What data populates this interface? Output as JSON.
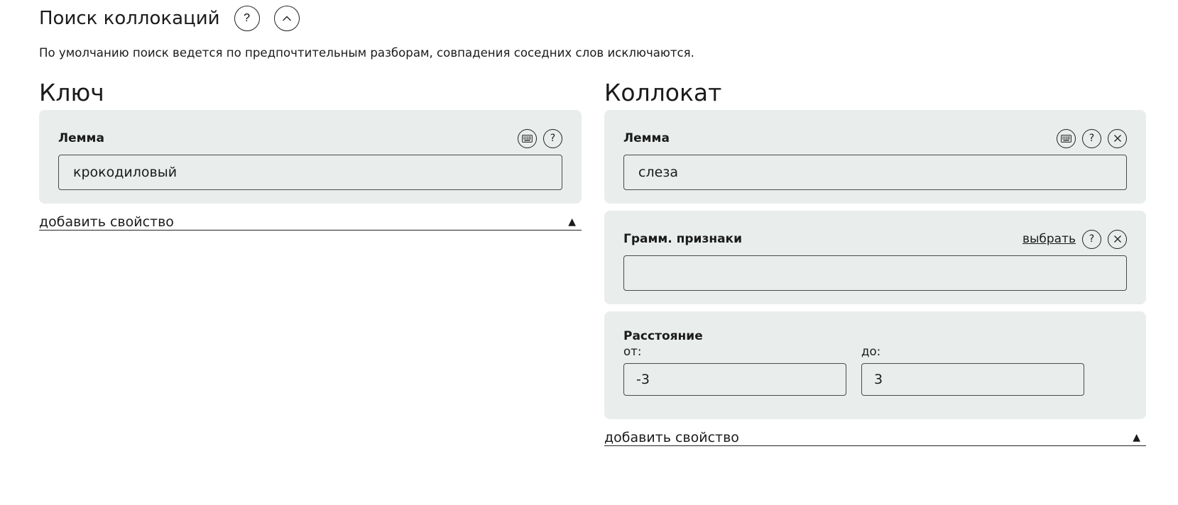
{
  "header": {
    "title": "Поиск коллокаций",
    "help_icon": "question-icon",
    "collapse_icon": "chevron-up-icon",
    "subtitle": "По умолчанию поиск ведется по предпочтительным разборам, совпадения соседних слов исключаются."
  },
  "key": {
    "title": "Ключ",
    "lemma": {
      "label": "Лемма",
      "value": "крокодиловый",
      "icons": [
        "keyboard-icon",
        "question-icon"
      ]
    },
    "add_property": "добавить свойство",
    "add_property_icon": "triangle-up-icon"
  },
  "collocate": {
    "title": "Коллокат",
    "lemma": {
      "label": "Лемма",
      "value": "слеза",
      "icons": [
        "keyboard-icon",
        "question-icon",
        "close-icon"
      ]
    },
    "gram": {
      "label": "Грамм. признаки",
      "choose_link": "выбрать",
      "value": "",
      "icons": [
        "question-icon",
        "close-icon"
      ]
    },
    "distance": {
      "label": "Расстояние",
      "from_label": "от:",
      "from_value": "-3",
      "to_label": "до:",
      "to_value": "3"
    },
    "add_property": "добавить свойство",
    "add_property_icon": "triangle-up-icon"
  },
  "colors": {
    "card_background": "#e9eeec",
    "text": "#1b1b1b",
    "border": "#4a4a4a"
  }
}
